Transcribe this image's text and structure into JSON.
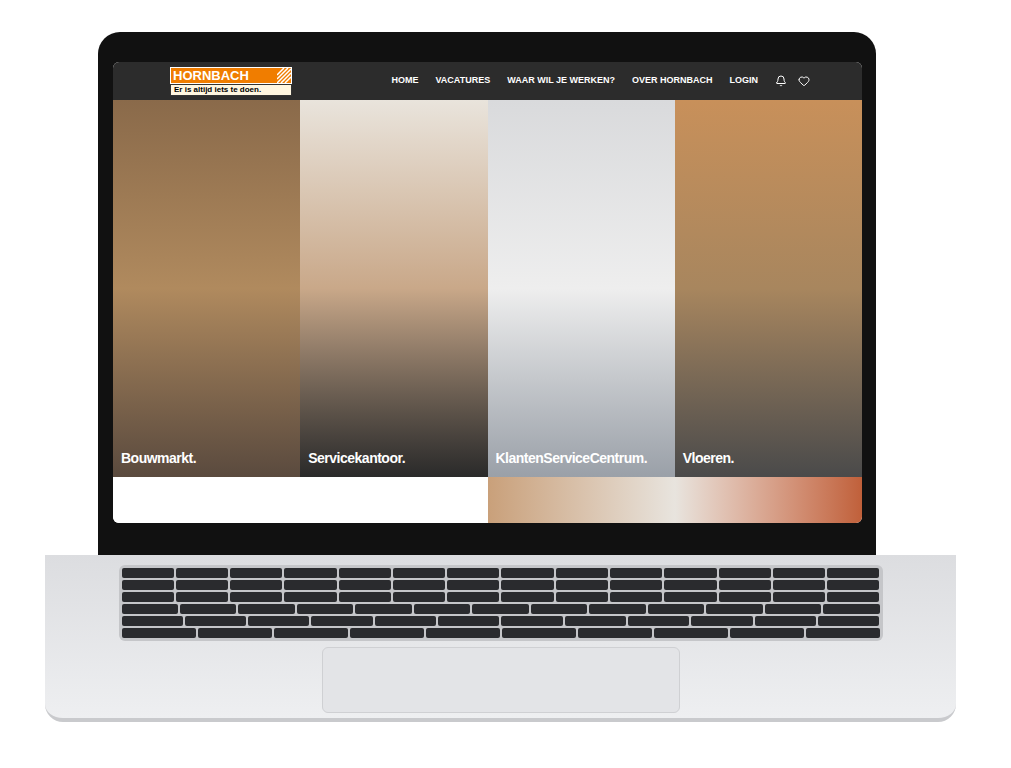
{
  "website": {
    "logo": {
      "name": "HORNBACH",
      "tagline": "Er is altijd iets te doen."
    },
    "nav": [
      {
        "label": "HOME"
      },
      {
        "label": "VACATURES"
      },
      {
        "label": "WAAR WIL JE WERKEN?"
      },
      {
        "label": "OVER HORNBACH"
      },
      {
        "label": "LOGIN"
      }
    ],
    "panels": [
      {
        "label": "Bouwmarkt."
      },
      {
        "label": "Servicekantoor."
      },
      {
        "label": "KlantenServiceCentrum."
      },
      {
        "label": "Vloeren."
      }
    ]
  }
}
